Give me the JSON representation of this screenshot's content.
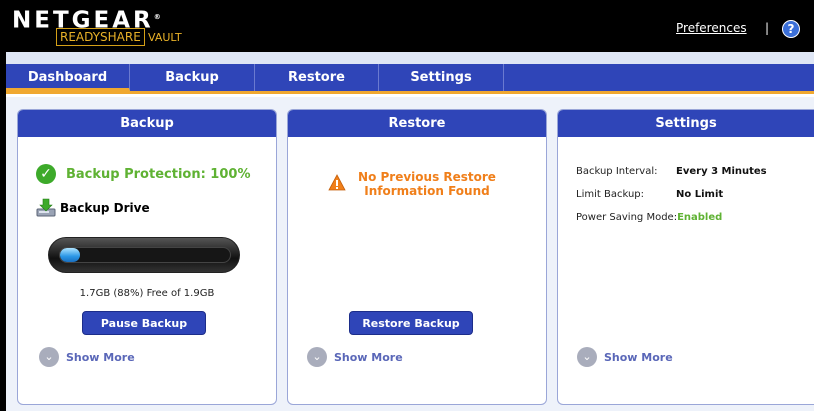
{
  "header": {
    "brand": "NETGEAR",
    "product_ready": "READYSHARE",
    "product_vault": "VAULT",
    "preferences_link": "Preferences",
    "separator": "|",
    "help_glyph": "?"
  },
  "nav": {
    "tabs": [
      {
        "label": "Dashboard",
        "active": true
      },
      {
        "label": "Backup",
        "active": false
      },
      {
        "label": "Restore",
        "active": false
      },
      {
        "label": "Settings",
        "active": false
      }
    ]
  },
  "backup_panel": {
    "title": "Backup",
    "protection_text": "Backup Protection: 100%",
    "drive_label": "Backup Drive",
    "storage_used_fraction": 0.12,
    "storage_text": "1.7GB (88%) Free of 1.9GB",
    "pause_button": "Pause Backup",
    "show_more": "Show More"
  },
  "restore_panel": {
    "title": "Restore",
    "warning_text": "No Previous Restore Information Found",
    "restore_button": "Restore Backup",
    "show_more": "Show More"
  },
  "settings_panel": {
    "title": "Settings",
    "rows": [
      {
        "key": "Backup Interval:",
        "value": "Every 3 Minutes"
      },
      {
        "key": "Limit Backup:",
        "value": "No Limit"
      },
      {
        "key": "Power Saving Mode:",
        "value": "Enabled"
      }
    ],
    "show_more": "Show More"
  },
  "colors": {
    "nav_blue": "#2f45b8",
    "accent_orange": "#f0a830",
    "success_green": "#5fb233",
    "warning_orange": "#f07f1a"
  },
  "icons": {
    "success": "check-circle-icon",
    "drive": "drive-download-icon",
    "warning": "warning-triangle-icon",
    "help": "help-icon",
    "expand": "chevron-down-icon"
  }
}
